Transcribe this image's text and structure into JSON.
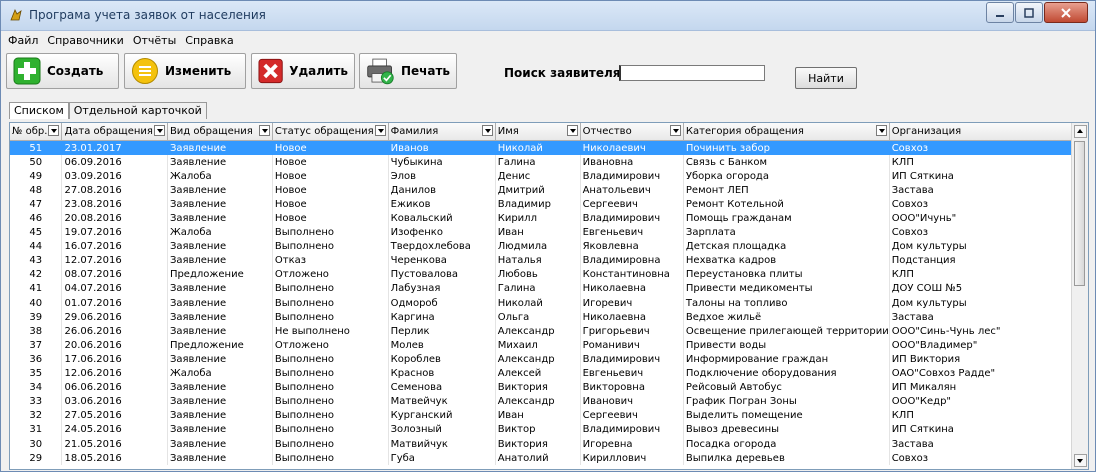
{
  "window": {
    "title": "Програма учета заявок от населения"
  },
  "menu": [
    "Файл",
    "Справочники",
    "Отчёты",
    "Справка"
  ],
  "toolbar": {
    "create_label": "Создать",
    "edit_label": "Изменить",
    "delete_label": "Удалить",
    "print_label": "Печать"
  },
  "search": {
    "label": "Поиск заявителя",
    "value": "",
    "button_label": "Найти"
  },
  "tabs": [
    {
      "label": "Списком",
      "active": true
    },
    {
      "label": "Отдельной карточкой",
      "active": false
    }
  ],
  "grid": {
    "columns": [
      "№ обр.",
      "Дата обращения",
      "Вид обращения",
      "Статус обращения",
      "Фамилия",
      "Имя",
      "Отчество",
      "Категория обращения",
      "Организация"
    ],
    "selected_index": 0,
    "rows": [
      [
        "51",
        "23.01.2017",
        "Заявление",
        "Новое",
        "Иванов",
        "Николай",
        "Николаевич",
        "Починить забор",
        "Совхоз"
      ],
      [
        "50",
        "06.09.2016",
        "Заявление",
        "Новое",
        "Чубыкина",
        "Галина",
        "Ивановна",
        "Связь с Банком",
        "КЛП"
      ],
      [
        "49",
        "03.09.2016",
        "Жалоба",
        "Новое",
        "Элов",
        "Денис",
        "Владимирович",
        "Уборка огорода",
        "ИП Сяткина"
      ],
      [
        "48",
        "27.08.2016",
        "Заявление",
        "Новое",
        "Данилов",
        "Дмитрий",
        "Анатольевич",
        "Ремонт ЛЕП",
        "Застава"
      ],
      [
        "47",
        "23.08.2016",
        "Заявление",
        "Новое",
        "Ежиков",
        "Владимир",
        "Сергеевич",
        "Ремонт Котельной",
        "Совхоз"
      ],
      [
        "46",
        "20.08.2016",
        "Заявление",
        "Новое",
        "Ковальский",
        "Кирилл",
        "Владимирович",
        "Помощь гражданам",
        "ООО\"Ичунь\""
      ],
      [
        "45",
        "19.07.2016",
        "Жалоба",
        "Выполнено",
        "Изофенко",
        "Иван",
        "Евгеньевич",
        "Зарплата",
        "Совхоз"
      ],
      [
        "44",
        "16.07.2016",
        "Заявление",
        "Выполнено",
        "Твердохлебова",
        "Людмила",
        "Яковлевна",
        "Детская площадка",
        "Дом культуры"
      ],
      [
        "43",
        "12.07.2016",
        "Заявление",
        "Отказ",
        "Черенкова",
        "Наталья",
        "Владимировна",
        "Нехватка кадров",
        "Подстанция"
      ],
      [
        "42",
        "08.07.2016",
        "Предложение",
        "Отложено",
        "Пустовалова",
        "Любовь",
        "Константиновна",
        "Переустановка плиты",
        "КЛП"
      ],
      [
        "41",
        "04.07.2016",
        "Заявление",
        "Выполнено",
        "Лабузная",
        "Галина",
        "Николаевна",
        "Привести медикоменты",
        "ДОУ СОШ №5"
      ],
      [
        "40",
        "01.07.2016",
        "Заявление",
        "Выполнено",
        "Одмороб",
        "Николай",
        "Игоревич",
        "Талоны на топливо",
        "Дом культуры"
      ],
      [
        "39",
        "29.06.2016",
        "Заявление",
        "Выполнено",
        "Каргина",
        "Ольга",
        "Николаевна",
        "Ведхое жильё",
        "Застава"
      ],
      [
        "38",
        "26.06.2016",
        "Заявление",
        "Не выполнено",
        "Перлик",
        "Александр",
        "Григорьевич",
        "Освещение прилегающей территории",
        "ООО\"Синь-Чунь лес\""
      ],
      [
        "37",
        "20.06.2016",
        "Предложение",
        "Отложено",
        "Молев",
        "Михаил",
        "Романивич",
        "Привести воды",
        "ООО\"Владимер\""
      ],
      [
        "36",
        "17.06.2016",
        "Заявление",
        "Выполнено",
        "Короблев",
        "Александр",
        "Владимирович",
        "Информирование граждан",
        "ИП Виктория"
      ],
      [
        "35",
        "12.06.2016",
        "Жалоба",
        "Выполнено",
        "Краснов",
        "Алексей",
        "Евгеньевич",
        "Подключение оборудования",
        "ОАО\"Совхоз Радде\""
      ],
      [
        "34",
        "06.06.2016",
        "Заявление",
        "Выполнено",
        "Семенова",
        "Виктория",
        "Викторовна",
        "Рейсовый Автобус",
        "ИП Микалян"
      ],
      [
        "33",
        "03.06.2016",
        "Заявление",
        "Выполнено",
        "Матвейчук",
        "Александр",
        "Иванович",
        "График Погран Зоны",
        "ООО\"Кедр\""
      ],
      [
        "32",
        "27.05.2016",
        "Заявление",
        "Выполнено",
        "Курганский",
        "Иван",
        "Сергеевич",
        "Выделить помещение",
        "КЛП"
      ],
      [
        "31",
        "24.05.2016",
        "Заявление",
        "Выполнено",
        "Золозный",
        "Виктор",
        "Владимирович",
        "Вывоз древесины",
        "ИП Сяткина"
      ],
      [
        "30",
        "21.05.2016",
        "Заявление",
        "Выполнено",
        "Матвийчук",
        "Виктория",
        "Игоревна",
        "Посадка огорода",
        "Застава"
      ],
      [
        "29",
        "18.05.2016",
        "Заявление",
        "Выполнено",
        "Губа",
        "Анатолий",
        "Кириллович",
        "Выпилка деревьев",
        "Совхоз"
      ]
    ]
  },
  "colors": {
    "selection": "#3399ff",
    "titlebar": "#c4d7ee"
  }
}
